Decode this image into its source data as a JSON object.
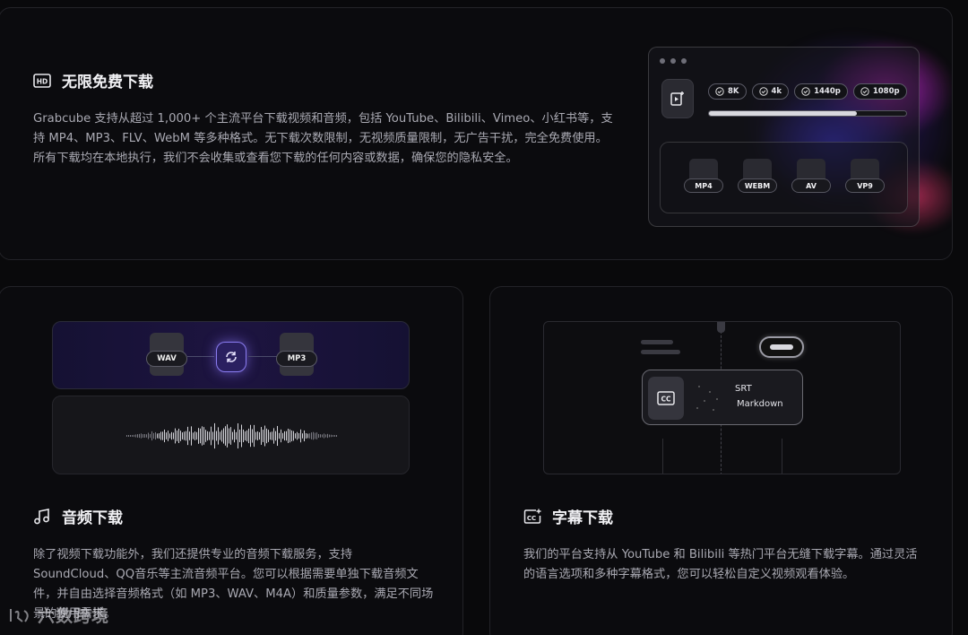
{
  "download": {
    "title": "无限免费下载",
    "description": "Grabcube 支持从超过 1,000+ 个主流平台下载视频和音频，包括 YouTube、Bilibili、Vimeo、小红书等，支持 MP4、MP3、FLV、WebM 等多种格式。无下载次数限制，无视频质量限制，无广告干扰，完全免费使用。所有下载均在本地执行，我们不会收集或查看您下载的任何内容或数据，确保您的隐私安全。",
    "resolutions": [
      "8K",
      "4k",
      "1440p",
      "1080p"
    ],
    "formats": [
      "MP4",
      "WEBM",
      "AV",
      "VP9"
    ],
    "progress": 0.75
  },
  "audio": {
    "title": "音频下载",
    "description": "除了视频下载功能外，我们还提供专业的音频下载服务，支持 SoundCloud、QQ音乐等主流音频平台。您可以根据需要单独下载音频文件，并自由选择音频格式（如 MP3、WAV、M4A）和质量参数，满足不同场景的使用需求。",
    "from_format": "WAV",
    "to_format": "MP3"
  },
  "subtitle": {
    "title": "字幕下载",
    "description": "我们的平台支持从 YouTube 和 Bilibili 等热门平台无缝下载字幕。通过灵活的语言选项和多种字幕格式，您可以轻松自定义视频观看体验。",
    "formats": [
      "SRT",
      "Markdown"
    ]
  },
  "watermark": "六数跨境",
  "icons": {
    "download": "hd-icon",
    "audio": "music-note-icon",
    "subtitle": "subtitle-icon"
  }
}
